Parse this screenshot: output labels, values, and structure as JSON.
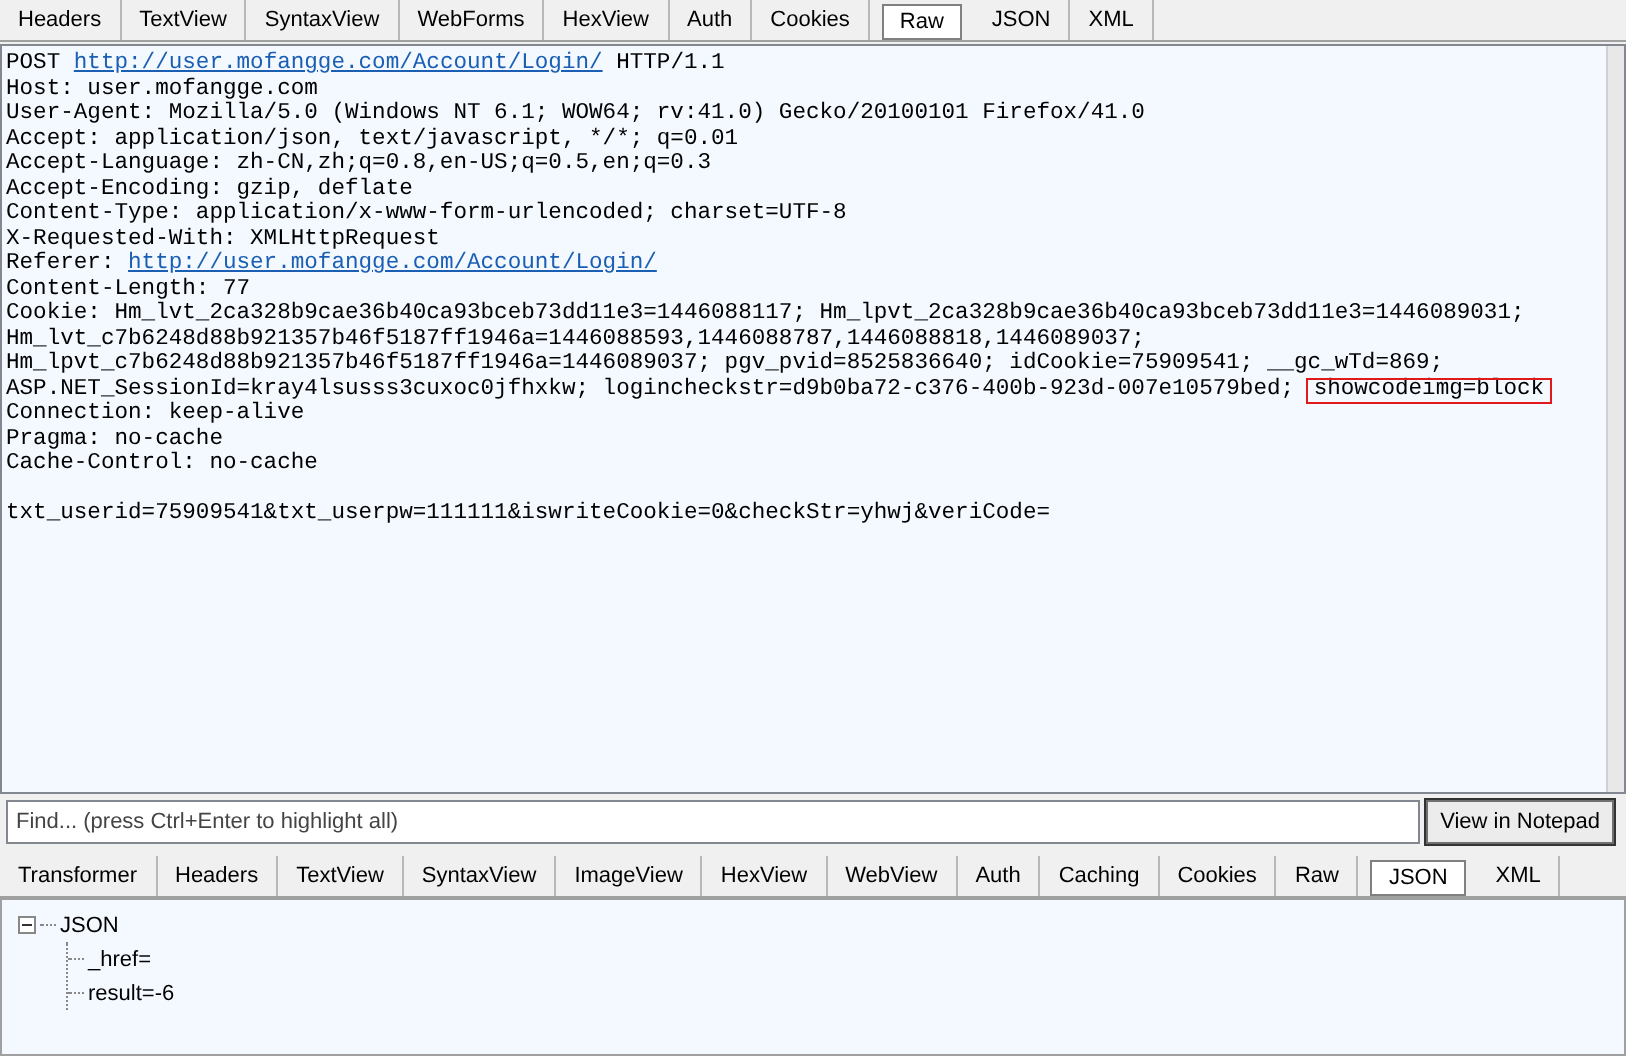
{
  "request_tabs": [
    {
      "label": "Headers",
      "selected": false
    },
    {
      "label": "TextView",
      "selected": false
    },
    {
      "label": "SyntaxView",
      "selected": false
    },
    {
      "label": "WebForms",
      "selected": false
    },
    {
      "label": "HexView",
      "selected": false
    },
    {
      "label": "Auth",
      "selected": false
    },
    {
      "label": "Cookies",
      "selected": false
    },
    {
      "label": "Raw",
      "selected": true
    },
    {
      "label": "JSON",
      "selected": false
    },
    {
      "label": "XML",
      "selected": false
    }
  ],
  "raw_lines": [
    [
      {
        "kind": "plain",
        "text": "POST "
      },
      {
        "kind": "link",
        "text": "http://user.mofangge.com/Account/Login/"
      },
      {
        "kind": "plain",
        "text": " HTTP/1.1"
      }
    ],
    [
      {
        "kind": "plain",
        "text": "Host: user.mofangge.com"
      }
    ],
    [
      {
        "kind": "plain",
        "text": "User-Agent: Mozilla/5.0 (Windows NT 6.1; WOW64; rv:41.0) Gecko/20100101 Firefox/41.0"
      }
    ],
    [
      {
        "kind": "plain",
        "text": "Accept: application/json, text/javascript, */*; q=0.01"
      }
    ],
    [
      {
        "kind": "plain",
        "text": "Accept-Language: zh-CN,zh;q=0.8,en-US;q=0.5,en;q=0.3"
      }
    ],
    [
      {
        "kind": "plain",
        "text": "Accept-Encoding: gzip, deflate"
      }
    ],
    [
      {
        "kind": "plain",
        "text": "Content-Type: application/x-www-form-urlencoded; charset=UTF-8"
      }
    ],
    [
      {
        "kind": "plain",
        "text": "X-Requested-With: XMLHttpRequest"
      }
    ],
    [
      {
        "kind": "plain",
        "text": "Referer: "
      },
      {
        "kind": "link",
        "text": "http://user.mofangge.com/Account/Login/"
      }
    ],
    [
      {
        "kind": "plain",
        "text": "Content-Length: 77"
      }
    ],
    [
      {
        "kind": "plain",
        "text": "Cookie: Hm_lvt_2ca328b9cae36b40ca93bceb73dd11e3=1446088117; Hm_lpvt_2ca328b9cae36b40ca93bceb73dd11e3=1446089031;"
      }
    ],
    [
      {
        "kind": "plain",
        "text": "Hm_lvt_c7b6248d88b921357b46f5187ff1946a=1446088593,1446088787,1446088818,1446089037;"
      }
    ],
    [
      {
        "kind": "plain",
        "text": "Hm_lpvt_c7b6248d88b921357b46f5187ff1946a=1446089037; pgv_pvid=8525836640; idCookie=75909541; __gc_wTd=869;"
      }
    ],
    [
      {
        "kind": "plain",
        "text": "ASP.NET_SessionId=kray4lsusss3cuxoc0jfhxkw; logincheckstr=d9b0ba72-c376-400b-923d-007e10579bed; "
      },
      {
        "kind": "highlight",
        "text": "showcodeimg=block"
      }
    ],
    [
      {
        "kind": "plain",
        "text": "Connection: keep-alive"
      }
    ],
    [
      {
        "kind": "plain",
        "text": "Pragma: no-cache"
      }
    ],
    [
      {
        "kind": "plain",
        "text": "Cache-Control: no-cache"
      }
    ]
  ],
  "raw_body": [
    {
      "kind": "plain",
      "text": "txt_userid=75909541&txt_userpw=111111&iswriteCookie=0&checkStr=yhwj&veriCode="
    }
  ],
  "find_bar": {
    "placeholder": "Find... (press Ctrl+Enter to highlight all)",
    "button": "View in Notepad"
  },
  "response_tabs": [
    {
      "label": "Transformer",
      "selected": false
    },
    {
      "label": "Headers",
      "selected": false
    },
    {
      "label": "TextView",
      "selected": false
    },
    {
      "label": "SyntaxView",
      "selected": false
    },
    {
      "label": "ImageView",
      "selected": false
    },
    {
      "label": "HexView",
      "selected": false
    },
    {
      "label": "WebView",
      "selected": false
    },
    {
      "label": "Auth",
      "selected": false
    },
    {
      "label": "Caching",
      "selected": false
    },
    {
      "label": "Cookies",
      "selected": false
    },
    {
      "label": "Raw",
      "selected": false
    },
    {
      "label": "JSON",
      "selected": true
    },
    {
      "label": "XML",
      "selected": false
    }
  ],
  "tree": [
    {
      "label": "JSON",
      "expanded": true,
      "children": [
        {
          "label": "_href="
        },
        {
          "label": "result=-6"
        }
      ]
    }
  ]
}
